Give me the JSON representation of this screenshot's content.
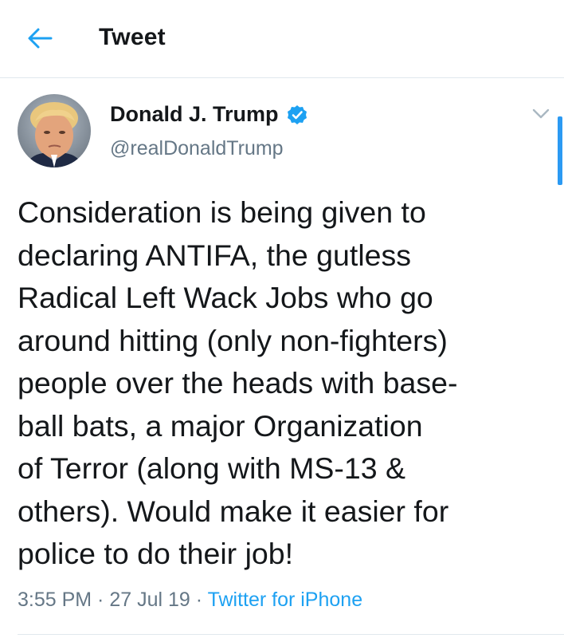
{
  "header": {
    "back_icon": "back-arrow-icon",
    "title": "Tweet"
  },
  "tweet": {
    "author": {
      "name": "Donald J. Trump",
      "handle": "@realDonaldTrump",
      "verified_icon": "verified-badge-icon",
      "avatar_icon": "avatar"
    },
    "menu_icon": "chevron-down-icon",
    "text_lines": [
      "Consideration is being given to",
      "declaring ANTIFA, the gutless",
      "Radical Left Wack Jobs who go",
      "around hitting (only non-fighters)",
      "people over the heads with base-",
      "ball bats, a major Organization",
      "of Terror (along with MS-13 &",
      "others). Would make it easier for",
      "police to do their job!"
    ],
    "time": "3:55 PM",
    "separator": " · ",
    "date": "27 Jul 19",
    "source": "Twitter for iPhone"
  },
  "colors": {
    "accent": "#1da1f2",
    "secondary_text": "#657786",
    "divider": "#e1e8ed"
  }
}
